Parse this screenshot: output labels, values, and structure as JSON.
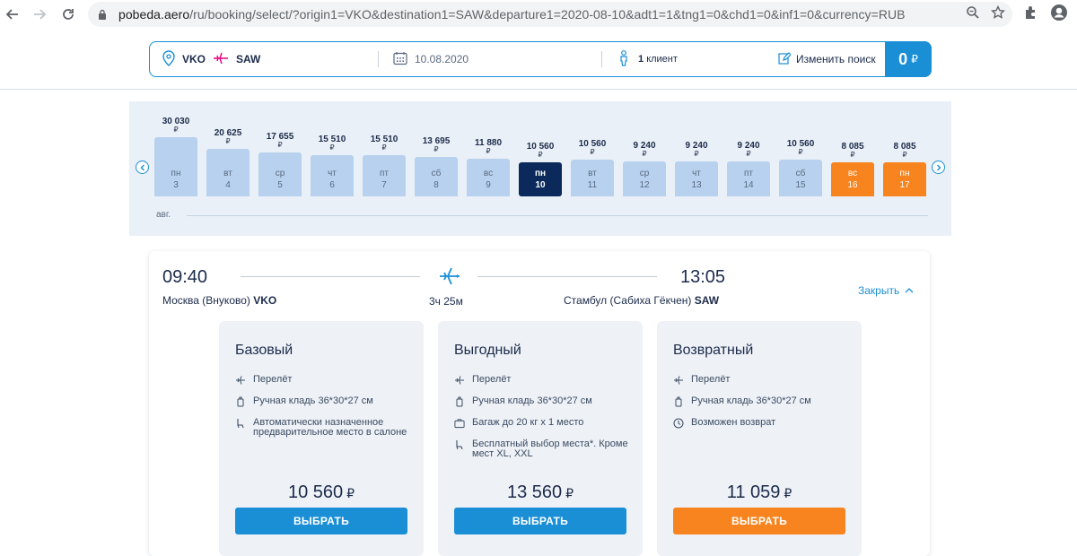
{
  "browser": {
    "url_host": "pobeda.aero",
    "url_rest": "/ru/booking/select/?origin1=VKO&destination1=SAW&departure1=2020-08-10&adt1=1&tng1=0&chd1=0&inf1=0&currency=RUB"
  },
  "search": {
    "origin": "VKO",
    "destination": "SAW",
    "date": "10.08.2020",
    "client_count": "1",
    "client_label": "клиент",
    "edit_label": "Изменить поиск",
    "total_price": "0",
    "currency": "₽"
  },
  "calendar": {
    "month": "авг.",
    "currency": "₽",
    "days": [
      {
        "price": "30 030",
        "weekday": "пн",
        "day": "3",
        "level": 0.9,
        "state": "normal"
      },
      {
        "price": "20 625",
        "weekday": "вт",
        "day": "4",
        "level": 0.72,
        "state": "normal"
      },
      {
        "price": "17 655",
        "weekday": "ср",
        "day": "5",
        "level": 0.66,
        "state": "normal"
      },
      {
        "price": "15 510",
        "weekday": "чт",
        "day": "6",
        "level": 0.62,
        "state": "normal"
      },
      {
        "price": "15 510",
        "weekday": "пт",
        "day": "7",
        "level": 0.62,
        "state": "normal"
      },
      {
        "price": "13 695",
        "weekday": "сб",
        "day": "8",
        "level": 0.59,
        "state": "normal"
      },
      {
        "price": "11 880",
        "weekday": "вс",
        "day": "9",
        "level": 0.56,
        "state": "normal"
      },
      {
        "price": "10 560",
        "weekday": "пн",
        "day": "10",
        "level": 0.54,
        "state": "selected"
      },
      {
        "price": "10 560",
        "weekday": "вт",
        "day": "11",
        "level": 0.54,
        "state": "normal"
      },
      {
        "price": "9 240",
        "weekday": "ср",
        "day": "12",
        "level": 0.52,
        "state": "normal"
      },
      {
        "price": "9 240",
        "weekday": "чт",
        "day": "13",
        "level": 0.52,
        "state": "normal"
      },
      {
        "price": "9 240",
        "weekday": "пт",
        "day": "14",
        "level": 0.52,
        "state": "normal"
      },
      {
        "price": "10 560",
        "weekday": "сб",
        "day": "15",
        "level": 0.54,
        "state": "normal"
      },
      {
        "price": "8 085",
        "weekday": "вс",
        "day": "16",
        "level": 0.5,
        "state": "cheapest"
      },
      {
        "price": "8 085",
        "weekday": "пн",
        "day": "17",
        "level": 0.5,
        "state": "cheapest"
      }
    ]
  },
  "flight": {
    "dep_time": "09:40",
    "arr_time": "13:05",
    "dep_city": "Москва (Внуково)",
    "dep_code": "VKO",
    "arr_city": "Стамбул (Сабиха Гёкчен)",
    "arr_code": "SAW",
    "duration": "3ч 25м",
    "close_label": "Закрыть"
  },
  "tariffs": [
    {
      "name": "Базовый",
      "features": [
        {
          "icon": "plane-icon",
          "text": "Перелёт"
        },
        {
          "icon": "hand-luggage-icon",
          "text": "Ручная кладь 36*30*27 см"
        },
        {
          "icon": "seat-icon",
          "text": "Автоматически назначенное предварительное место в салоне"
        }
      ],
      "price": "10 560",
      "currency": "₽",
      "button": "ВЫБРАТЬ",
      "accent": "#1a8fd6"
    },
    {
      "name": "Выгодный",
      "features": [
        {
          "icon": "plane-icon",
          "text": "Перелёт"
        },
        {
          "icon": "hand-luggage-icon",
          "text": "Ручная кладь 36*30*27 см"
        },
        {
          "icon": "baggage-icon",
          "text": "Багаж до 20 кг х 1 место"
        },
        {
          "icon": "seat-icon",
          "text": "Бесплатный выбор места*. Кроме мест XL, XXL"
        }
      ],
      "price": "13 560",
      "currency": "₽",
      "button": "ВЫБРАТЬ",
      "accent": "#1a8fd6"
    },
    {
      "name": "Возвратный",
      "features": [
        {
          "icon": "plane-icon",
          "text": "Перелёт"
        },
        {
          "icon": "hand-luggage-icon",
          "text": "Ручная кладь 36*30*27 см"
        },
        {
          "icon": "clock-icon",
          "text": "Возможен возврат"
        }
      ],
      "price": "11 059",
      "currency": "₽",
      "button": "ВЫБРАТЬ",
      "accent": "#f7841f"
    }
  ]
}
